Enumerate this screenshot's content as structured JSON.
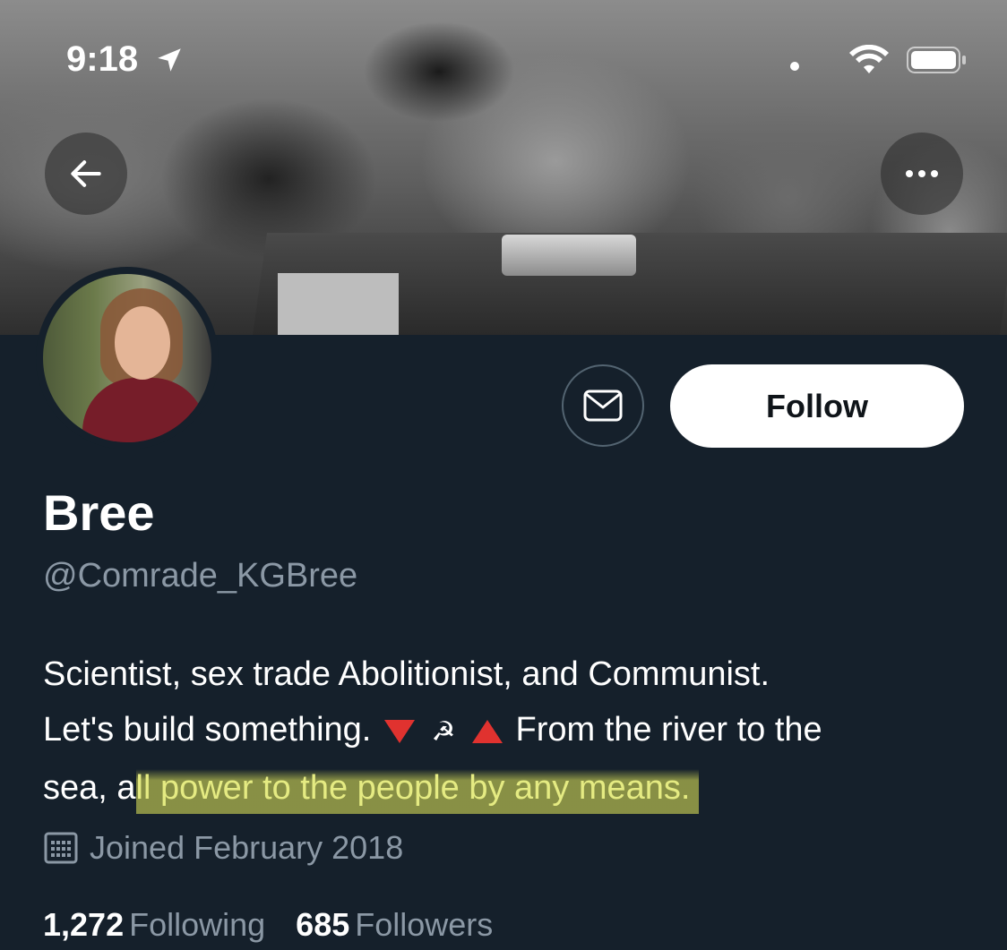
{
  "status_bar": {
    "time": "9:18",
    "icons": [
      "location-arrow-icon",
      "wifi-icon",
      "battery-icon"
    ]
  },
  "header": {
    "back_icon": "arrow-left-icon",
    "more_icon": "more-horizontal-icon"
  },
  "profile": {
    "name": "Bree",
    "handle": "@Comrade_KGBree",
    "follow_label": "Follow",
    "message_icon": "mail-icon",
    "bio": {
      "line1": "Scientist, sex trade Abolitionist, and Communist.",
      "line2_start": "Let's build something.",
      "line2_emoji_hs": "☭",
      "line2_end": "From the river to the",
      "line3_start": "sea, a",
      "line3_highlight": "ll power to the people by any means."
    },
    "joined": "Joined February 2018",
    "following_count": "1,272",
    "following_label": "Following",
    "followers_count": "685",
    "followers_label": "Followers"
  },
  "colors": {
    "background": "#15202b",
    "secondary_text": "#8b98a5",
    "highlight": "#e6eb5a",
    "emoji_red": "#e0322f"
  }
}
